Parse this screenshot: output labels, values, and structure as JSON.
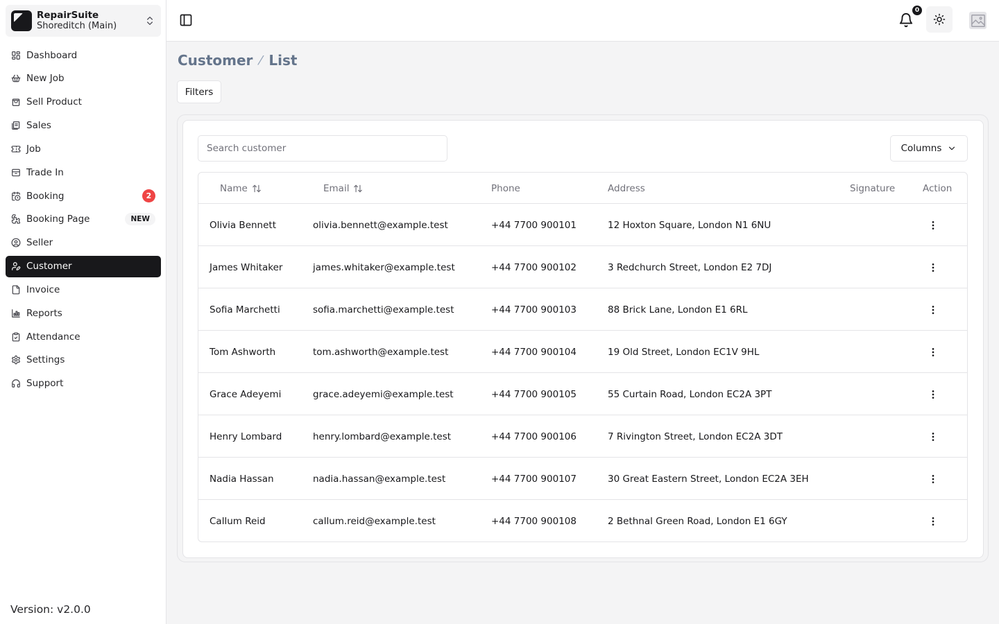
{
  "workspace": {
    "name": "RepairSuite",
    "branch": "Shoreditch (Main)"
  },
  "nav": {
    "dashboard": "Dashboard",
    "new_job": "New Job",
    "sell_product": "Sell Product",
    "sales": "Sales",
    "job": "Job",
    "trade_in": "Trade In",
    "booking": "Booking",
    "booking_count": "2",
    "booking_page": "Booking Page",
    "booking_page_badge": "NEW",
    "seller": "Seller",
    "customer": "Customer",
    "invoice": "Invoice",
    "reports": "Reports",
    "attendance": "Attendance",
    "settings": "Settings",
    "support": "Support"
  },
  "version": "Version: v2.0.0",
  "topbar": {
    "notification_count": "0"
  },
  "breadcrumb": {
    "section": "Customer",
    "page": "List"
  },
  "filters_label": "Filters",
  "search": {
    "placeholder": "Search customer",
    "value": ""
  },
  "columns_label": "Columns",
  "table": {
    "headers": {
      "name": "Name",
      "email": "Email",
      "phone": "Phone",
      "address": "Address",
      "signature": "Signature",
      "action": "Action"
    },
    "rows": [
      {
        "name": "Olivia Bennett",
        "email": "olivia.bennett@example.test",
        "phone": "+44 7700 900101",
        "address": "12 Hoxton Square, London N1 6NU"
      },
      {
        "name": "James Whitaker",
        "email": "james.whitaker@example.test",
        "phone": "+44 7700 900102",
        "address": "3 Redchurch Street, London E2 7DJ"
      },
      {
        "name": "Sofia Marchetti",
        "email": "sofia.marchetti@example.test",
        "phone": "+44 7700 900103",
        "address": "88 Brick Lane, London E1 6RL"
      },
      {
        "name": "Tom Ashworth",
        "email": "tom.ashworth@example.test",
        "phone": "+44 7700 900104",
        "address": "19 Old Street, London EC1V 9HL"
      },
      {
        "name": "Grace Adeyemi",
        "email": "grace.adeyemi@example.test",
        "phone": "+44 7700 900105",
        "address": "55 Curtain Road, London EC2A 3PT"
      },
      {
        "name": "Henry Lombard",
        "email": "henry.lombard@example.test",
        "phone": "+44 7700 900106",
        "address": "7 Rivington Street, London EC2A 3DT"
      },
      {
        "name": "Nadia Hassan",
        "email": "nadia.hassan@example.test",
        "phone": "+44 7700 900107",
        "address": "30 Great Eastern Street, London EC2A 3EH"
      },
      {
        "name": "Callum Reid",
        "email": "callum.reid@example.test",
        "phone": "+44 7700 900108",
        "address": "2 Bethnal Green Road, London E1 6GY"
      }
    ]
  },
  "icons": {
    "workspace_switch": "chevrons-up-down-icon",
    "sidebar_toggle": "panel-left-icon",
    "notifications": "bell-icon",
    "theme": "sun-icon",
    "avatar": "image-placeholder-icon",
    "sort": "arrow-up-down-icon",
    "row_action": "more-vertical-icon"
  },
  "colors": {
    "active_nav": "#18181b",
    "badge_red": "#ef4444",
    "breadcrumb": "#64748b"
  }
}
